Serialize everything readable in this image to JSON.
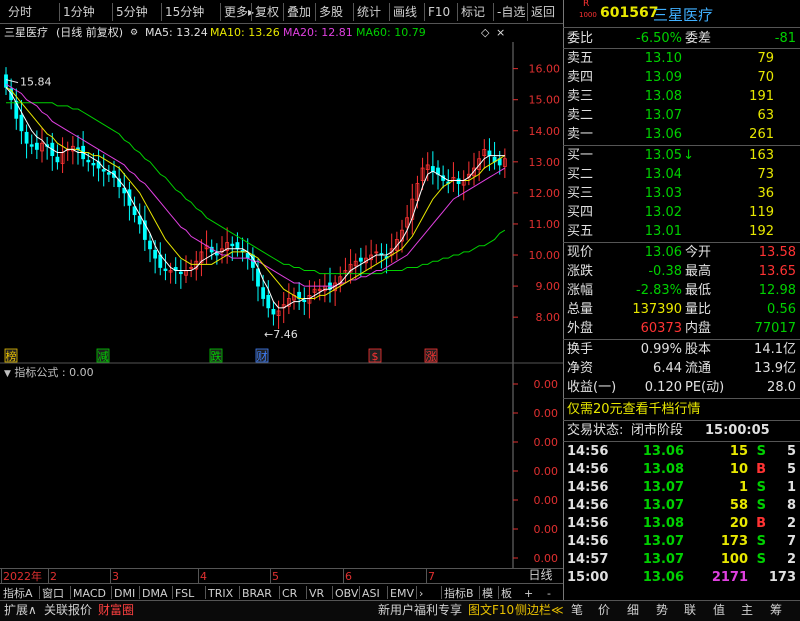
{
  "toolbar": {
    "items": [
      "分时",
      "1分钟",
      "5分钟",
      "15分钟",
      "更多",
      "复权",
      "叠加",
      "多股",
      "统计",
      "画线",
      "F10",
      "标记",
      "-自选",
      "返回"
    ]
  },
  "chart_header": {
    "stock_title": "三星医疗",
    "period": "(日线 前复权)",
    "ma5": "MA5: 13.24",
    "ma10": "MA10: 13.26",
    "ma20": "MA20: 12.81",
    "ma60": "MA60: 10.79"
  },
  "colors": {
    "ma5": "#ffffff",
    "ma10": "#e8e800",
    "ma20": "#e040e0",
    "ma60": "#00d000",
    "up": "#ff3333",
    "down": "#00ffff",
    "axis": "#e03030"
  },
  "chart_data": {
    "type": "candlestick",
    "y_ticks": [
      "16.00",
      "15.00",
      "14.00",
      "13.00",
      "12.00",
      "11.00",
      "10.00",
      "9.00",
      "8.00"
    ],
    "ylim": [
      7.2,
      16.6
    ],
    "annotations": {
      "high": "15.84",
      "low": "←7.46"
    },
    "x_ticks": [
      "2022年",
      "2",
      "3",
      "4",
      "5",
      "6",
      "7"
    ],
    "closes": [
      15.4,
      15.0,
      14.4,
      14.0,
      13.6,
      13.5,
      13.4,
      13.6,
      13.5,
      13.2,
      13.0,
      13.3,
      13.4,
      13.5,
      13.4,
      13.1,
      13.0,
      12.9,
      12.8,
      12.7,
      12.6,
      12.5,
      12.2,
      12.0,
      11.6,
      11.3,
      11.0,
      10.5,
      10.2,
      9.9,
      9.6,
      9.5,
      9.5,
      9.5,
      9.4,
      9.5,
      9.6,
      9.8,
      10.1,
      10.3,
      10.1,
      10.0,
      10.2,
      10.4,
      10.3,
      10.2,
      10.1,
      9.9,
      9.6,
      9.0,
      8.6,
      8.3,
      8.1,
      8.2,
      8.4,
      8.6,
      8.7,
      8.6,
      8.5,
      8.7,
      8.9,
      8.9,
      9.0,
      8.9,
      9.1,
      9.3,
      9.5,
      9.7,
      9.8,
      9.8,
      9.9,
      10.0,
      10.1,
      10.0,
      9.9,
      10.2,
      10.5,
      10.8,
      11.2,
      11.8,
      12.3,
      12.8,
      12.9,
      12.7,
      12.6,
      12.4,
      12.3,
      12.5,
      12.3,
      12.4,
      12.6,
      12.8,
      13.1,
      13.4,
      13.2,
      13.0,
      12.9,
      13.1
    ],
    "ma5": [
      15.4,
      15.2,
      14.9,
      14.6,
      14.3,
      14.0,
      13.8,
      13.7,
      13.5,
      13.4,
      13.3,
      13.3,
      13.4,
      13.4,
      13.3,
      13.3,
      13.2,
      13.1,
      13.0,
      12.8,
      12.7,
      12.6,
      12.4,
      12.2,
      11.9,
      11.6,
      11.3,
      11.0,
      10.7,
      10.3,
      10.0,
      9.8,
      9.6,
      9.5,
      9.5,
      9.5,
      9.5,
      9.6,
      9.8,
      9.9,
      10.0,
      10.1,
      10.1,
      10.2,
      10.2,
      10.2,
      10.2,
      10.1,
      9.9,
      9.6,
      9.2,
      8.9,
      8.5,
      8.3,
      8.3,
      8.4,
      8.5,
      8.5,
      8.6,
      8.6,
      8.7,
      8.8,
      8.9,
      8.9,
      9.0,
      9.1,
      9.3,
      9.5,
      9.6,
      9.7,
      9.8,
      9.9,
      10.0,
      10.0,
      10.0,
      10.1,
      10.3,
      10.5,
      10.8,
      11.2,
      11.7,
      12.2,
      12.6,
      12.7,
      12.6,
      12.5,
      12.4,
      12.4,
      12.4,
      12.4,
      12.5,
      12.7,
      12.9,
      13.1,
      13.2,
      13.2,
      13.2,
      13.2
    ],
    "ma10": [
      15.4,
      15.3,
      15.1,
      14.9,
      14.7,
      14.5,
      14.3,
      14.1,
      13.9,
      13.8,
      13.6,
      13.5,
      13.4,
      13.4,
      13.4,
      13.3,
      13.3,
      13.2,
      13.2,
      13.1,
      13.0,
      12.9,
      12.8,
      12.6,
      12.4,
      12.2,
      12.0,
      11.7,
      11.4,
      11.1,
      10.8,
      10.5,
      10.3,
      10.1,
      9.9,
      9.8,
      9.7,
      9.7,
      9.7,
      9.7,
      9.7,
      9.8,
      9.9,
      10.0,
      10.1,
      10.1,
      10.1,
      10.1,
      10.0,
      9.9,
      9.7,
      9.5,
      9.3,
      9.1,
      8.9,
      8.8,
      8.7,
      8.6,
      8.6,
      8.6,
      8.6,
      8.7,
      8.7,
      8.8,
      8.9,
      9.0,
      9.1,
      9.2,
      9.3,
      9.4,
      9.5,
      9.6,
      9.7,
      9.8,
      9.9,
      10.0,
      10.1,
      10.2,
      10.4,
      10.6,
      10.9,
      11.2,
      11.5,
      11.8,
      12.0,
      12.2,
      12.3,
      12.4,
      12.4,
      12.4,
      12.4,
      12.5,
      12.6,
      12.8,
      12.9,
      13.0,
      13.1,
      13.2
    ],
    "ma20": [
      15.5,
      15.4,
      15.3,
      15.2,
      15.0,
      14.9,
      14.8,
      14.6,
      14.5,
      14.3,
      14.2,
      14.1,
      14.0,
      13.9,
      13.8,
      13.7,
      13.6,
      13.5,
      13.4,
      13.3,
      13.2,
      13.1,
      13.0,
      12.9,
      12.7,
      12.6,
      12.4,
      12.3,
      12.1,
      11.9,
      11.7,
      11.5,
      11.3,
      11.1,
      10.9,
      10.8,
      10.6,
      10.5,
      10.4,
      10.3,
      10.2,
      10.1,
      10.0,
      10.0,
      9.9,
      9.9,
      9.9,
      9.9,
      9.8,
      9.8,
      9.7,
      9.6,
      9.5,
      9.4,
      9.3,
      9.2,
      9.1,
      9.1,
      9.0,
      9.0,
      9.0,
      9.0,
      9.0,
      9.0,
      9.0,
      9.1,
      9.1,
      9.2,
      9.2,
      9.3,
      9.3,
      9.4,
      9.5,
      9.5,
      9.6,
      9.7,
      9.8,
      9.9,
      10.0,
      10.2,
      10.4,
      10.6,
      10.8,
      11.0,
      11.2,
      11.4,
      11.6,
      11.8,
      11.9,
      12.0,
      12.1,
      12.2,
      12.3,
      12.4,
      12.5,
      12.6,
      12.7,
      12.8
    ],
    "ma60": [
      14.9,
      14.9,
      14.9,
      14.9,
      14.9,
      14.9,
      14.9,
      14.9,
      14.9,
      14.9,
      14.8,
      14.8,
      14.8,
      14.7,
      14.7,
      14.6,
      14.5,
      14.4,
      14.3,
      14.2,
      14.1,
      14.0,
      13.9,
      13.7,
      13.6,
      13.4,
      13.3,
      13.1,
      13.0,
      12.8,
      12.6,
      12.5,
      12.3,
      12.1,
      12.0,
      11.8,
      11.7,
      11.5,
      11.4,
      11.2,
      11.1,
      11.0,
      10.9,
      10.8,
      10.7,
      10.6,
      10.5,
      10.4,
      10.3,
      10.2,
      10.1,
      10.0,
      9.9,
      9.8,
      9.7,
      9.7,
      9.6,
      9.6,
      9.5,
      9.5,
      9.5,
      9.4,
      9.4,
      9.4,
      9.4,
      9.4,
      9.4,
      9.4,
      9.4,
      9.4,
      9.4,
      9.4,
      9.4,
      9.4,
      9.5,
      9.5,
      9.5,
      9.5,
      9.6,
      9.6,
      9.6,
      9.7,
      9.7,
      9.8,
      9.8,
      9.9,
      9.9,
      10.0,
      10.0,
      10.1,
      10.1,
      10.2,
      10.3,
      10.3,
      10.4,
      10.5,
      10.7,
      10.8
    ],
    "markers": [
      {
        "label": "榜",
        "pos": 0.01,
        "color": "#e8c000"
      },
      {
        "label": "减",
        "pos": 0.19,
        "color": "#00d000"
      },
      {
        "label": "跌",
        "pos": 0.41,
        "color": "#00d000"
      },
      {
        "label": "财",
        "pos": 0.5,
        "color": "#4080ff"
      },
      {
        "label": "$",
        "pos": 0.72,
        "color": "#ff3333"
      },
      {
        "label": "涨",
        "pos": 0.83,
        "color": "#ff3333"
      }
    ]
  },
  "indicator": {
    "label": "指标公式 : 0.00",
    "ticks": [
      "0.00",
      "0.00",
      "0.00",
      "0.00",
      "0.00",
      "0.00",
      "0.00"
    ]
  },
  "bottom_tabs": {
    "items": [
      "指标A",
      "窗口",
      "MACD",
      "DMI",
      "DMA",
      "FSL",
      "TRIX",
      "BRAR",
      "CR",
      "VR",
      "OBV",
      "ASI",
      "EMV",
      "›",
      "指标B",
      "模",
      "板"
    ],
    "right": [
      "+",
      "-",
      "日线"
    ]
  },
  "status_bar": {
    "left": [
      "扩展∧",
      "关联报价",
      "财富圈"
    ],
    "right": [
      "新用户福利专享",
      "图文F10",
      "侧边栏≪",
      "笔",
      "价",
      "细",
      "势",
      "联",
      "值",
      "主",
      "筹"
    ]
  },
  "quote": {
    "code": "601567",
    "name": "三星医疗",
    "badge_r": "R",
    "badge_l": "1000",
    "weibi_label": "委比",
    "weibi": "-6.50%",
    "weicha_label": "委差",
    "weicha": "-81",
    "asks": [
      {
        "label": "卖五",
        "price": "13.10",
        "vol": "79"
      },
      {
        "label": "卖四",
        "price": "13.09",
        "vol": "70"
      },
      {
        "label": "卖三",
        "price": "13.08",
        "vol": "191"
      },
      {
        "label": "卖二",
        "price": "13.07",
        "vol": "63"
      },
      {
        "label": "卖一",
        "price": "13.06",
        "vol": "261"
      }
    ],
    "bids": [
      {
        "label": "买一",
        "price": "13.05",
        "vol": "163",
        "arrow": "↓"
      },
      {
        "label": "买二",
        "price": "13.04",
        "vol": "73",
        "arrow": ""
      },
      {
        "label": "买三",
        "price": "13.03",
        "vol": "36",
        "arrow": ""
      },
      {
        "label": "买四",
        "price": "13.02",
        "vol": "119",
        "arrow": ""
      },
      {
        "label": "买五",
        "price": "13.01",
        "vol": "192",
        "arrow": ""
      }
    ],
    "stats": [
      {
        "l1": "现价",
        "v1": "13.06",
        "c1": "green",
        "l2": "今开",
        "v2": "13.58",
        "c2": "red"
      },
      {
        "l1": "涨跌",
        "v1": "-0.38",
        "c1": "green",
        "l2": "最高",
        "v2": "13.65",
        "c2": "red"
      },
      {
        "l1": "涨幅",
        "v1": "-2.83%",
        "c1": "green",
        "l2": "最低",
        "v2": "12.98",
        "c2": "green"
      },
      {
        "l1": "总量",
        "v1": "137390",
        "c1": "yellow",
        "l2": "量比",
        "v2": "0.56",
        "c2": "green"
      },
      {
        "l1": "外盘",
        "v1": "60373",
        "c1": "red",
        "l2": "内盘",
        "v2": "77017",
        "c2": "green"
      }
    ],
    "stats2": [
      {
        "l1": "换手",
        "v1": "0.99%",
        "l2": "股本",
        "v2": "14.1亿"
      },
      {
        "l1": "净资",
        "v1": "6.44",
        "l2": "流通",
        "v2": "13.9亿"
      },
      {
        "l1": "收益(一)",
        "v1": "0.120",
        "l2": "PE(动)",
        "v2": "28.0"
      }
    ],
    "promo": "仅需20元查看千档行情",
    "trade_status_label": "交易状态:",
    "trade_status": "闭市阶段",
    "trade_time": "15:00:05",
    "ticks": [
      {
        "time": "14:56",
        "price": "13.06",
        "vol": "15",
        "bs": "S",
        "n": "5"
      },
      {
        "time": "14:56",
        "price": "13.08",
        "vol": "10",
        "bs": "B",
        "n": "5"
      },
      {
        "time": "14:56",
        "price": "13.07",
        "vol": "1",
        "bs": "S",
        "n": "1"
      },
      {
        "time": "14:56",
        "price": "13.07",
        "vol": "58",
        "bs": "S",
        "n": "8"
      },
      {
        "time": "14:56",
        "price": "13.08",
        "vol": "20",
        "bs": "B",
        "n": "2"
      },
      {
        "time": "14:56",
        "price": "13.07",
        "vol": "173",
        "bs": "S",
        "n": "7"
      },
      {
        "time": "14:57",
        "price": "13.07",
        "vol": "100",
        "bs": "S",
        "n": "2"
      },
      {
        "time": "15:00",
        "price": "13.06",
        "vol": "2171",
        "bs": "",
        "n": "173"
      }
    ]
  }
}
